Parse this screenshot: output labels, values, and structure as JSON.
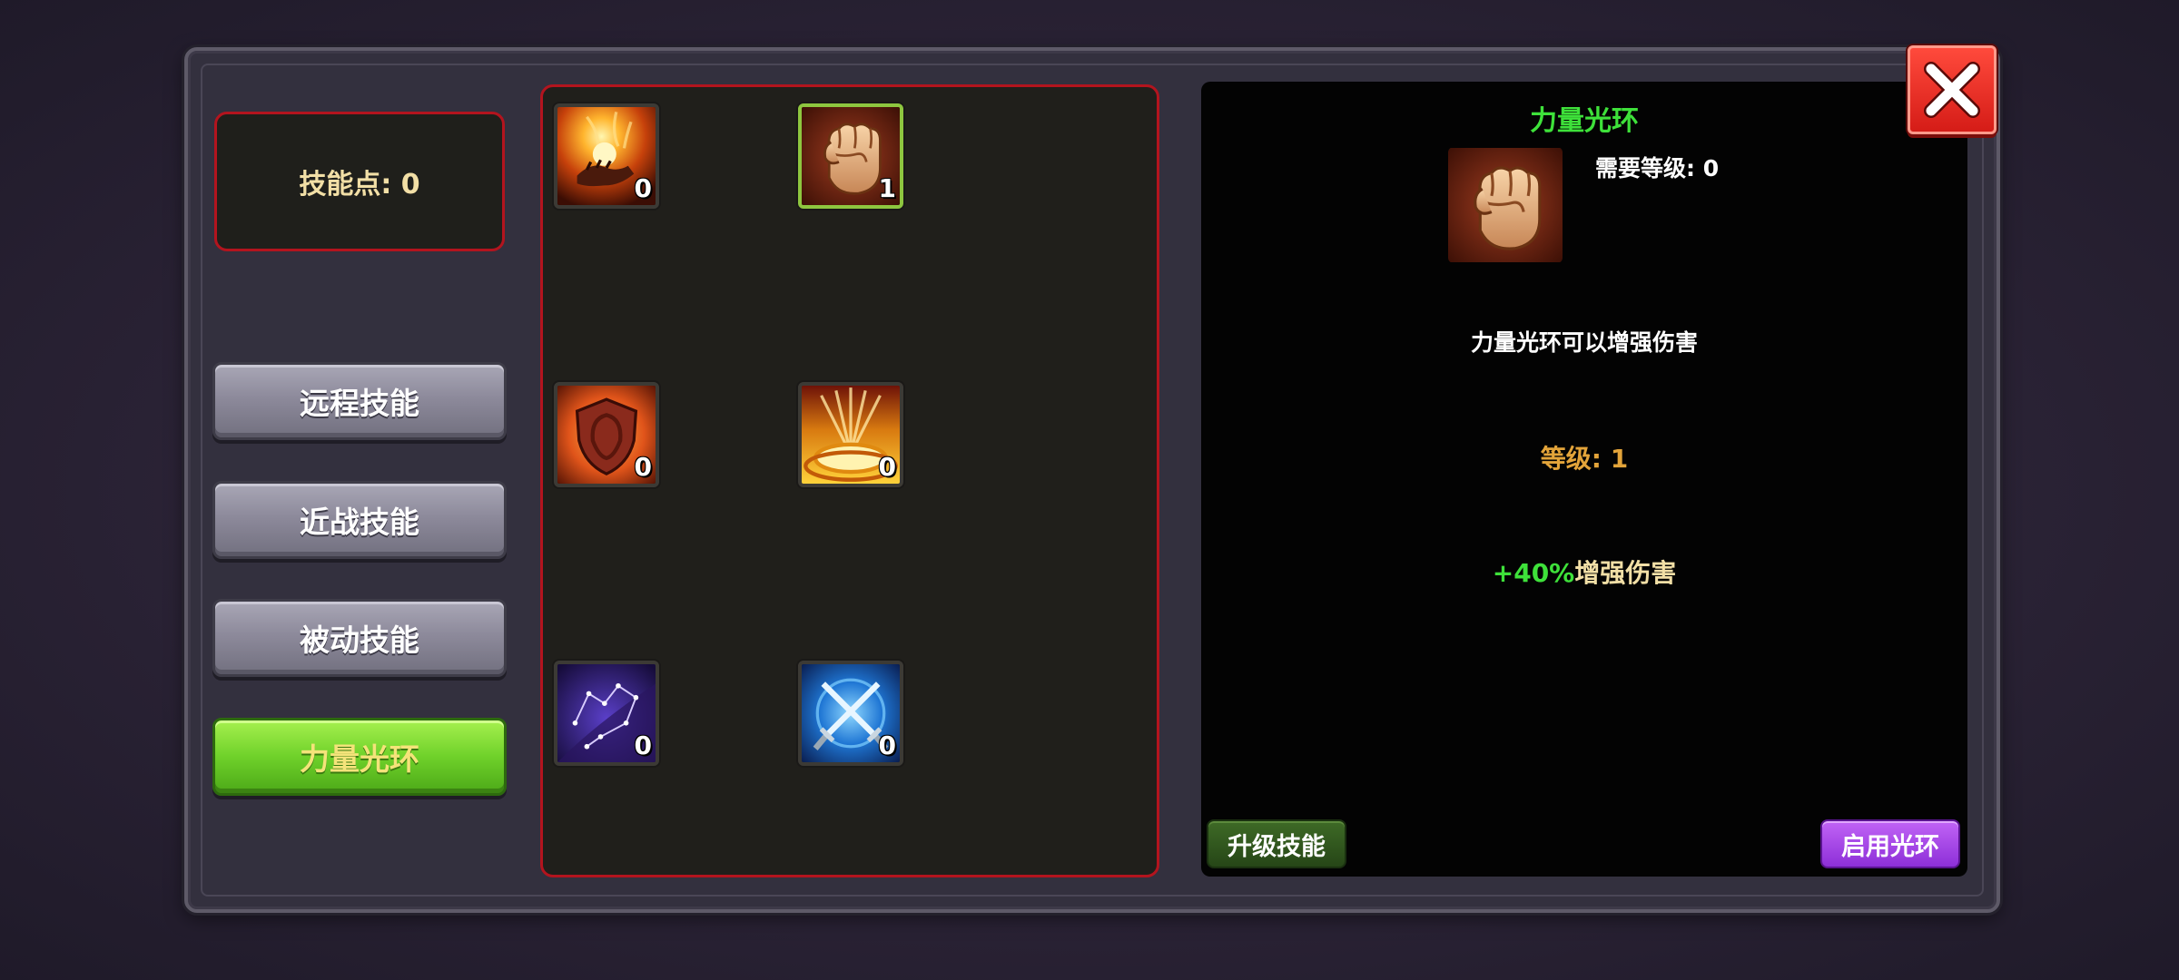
{
  "skill_points": {
    "text": "技能点: 0"
  },
  "tabs": [
    {
      "label": "远程技能",
      "active": false
    },
    {
      "label": "近战技能",
      "active": false
    },
    {
      "label": "被动技能",
      "active": false
    },
    {
      "label": "力量光环",
      "active": true
    }
  ],
  "skills": [
    {
      "icon": "fire-hand-icon",
      "level": "0",
      "selected": false
    },
    {
      "icon": "fist-icon",
      "level": "1",
      "selected": true
    },
    {
      "icon": "shield-icon",
      "level": "0",
      "selected": false
    },
    {
      "icon": "golden-burst-icon",
      "level": "0",
      "selected": false
    },
    {
      "icon": "constellation-icon",
      "level": "0",
      "selected": false
    },
    {
      "icon": "crossed-swords-icon",
      "level": "0",
      "selected": false
    }
  ],
  "detail": {
    "title": "力量光环",
    "icon": "fist-icon",
    "required_level": "需要等级: 0",
    "description": "力量光环可以增强伤害",
    "level": "等级: 1",
    "effect_value": "+40%",
    "effect_text": "增强伤害",
    "upgrade_label": "升级技能",
    "activate_label": "启用光环"
  },
  "colors": {
    "active_tab": "#6fd12a",
    "title_green": "#3ee13a",
    "level_orange": "#e3a43a",
    "close_red": "#e0271f",
    "activate_purple": "#a84ae8",
    "upgrade_green": "#2f5a1e"
  }
}
